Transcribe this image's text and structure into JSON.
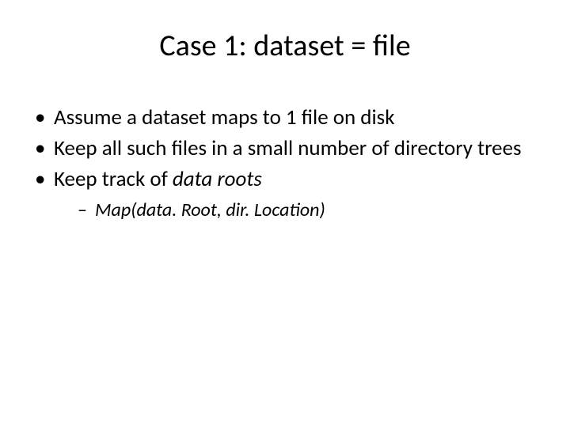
{
  "slide": {
    "title": "Case 1: dataset = file",
    "bullets": [
      {
        "text": "Assume a dataset maps to 1 file on disk"
      },
      {
        "text": "Keep all such files in a small number of directory trees"
      },
      {
        "text_prefix": "Keep track of ",
        "text_italic": "data roots",
        "sub": [
          {
            "text": "Map(data. Root, dir. Location)"
          }
        ]
      }
    ]
  }
}
